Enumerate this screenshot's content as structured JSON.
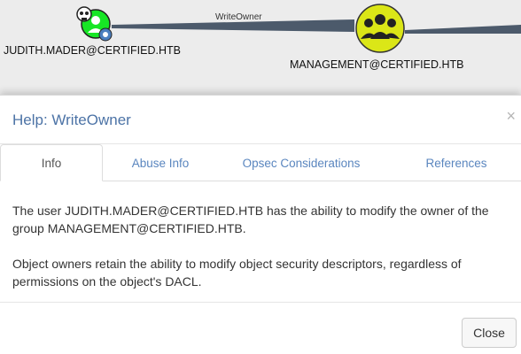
{
  "graph": {
    "edge_label": "WriteOwner",
    "source_node": {
      "label": "JUDITH.MADER@CERTIFIED.HTB",
      "icon": "user-icon"
    },
    "target_node": {
      "label": "MANAGEMENT@CERTIFIED.HTB",
      "icon": "group-icon"
    },
    "colors": {
      "user_node": "#17e625",
      "group_node": "#dbe617",
      "edge": "#4c5a6b"
    }
  },
  "modal": {
    "title": "Help: WriteOwner",
    "close_symbol": "×",
    "tabs": [
      {
        "label": "Info",
        "active": true
      },
      {
        "label": "Abuse Info",
        "active": false
      },
      {
        "label": "Opsec Considerations",
        "active": false
      },
      {
        "label": "References",
        "active": false
      }
    ],
    "body": {
      "paragraph_1": "The user JUDITH.MADER@CERTIFIED.HTB has the ability to modify the owner of the group MANAGEMENT@CERTIFIED.HTB.",
      "paragraph_2": "Object owners retain the ability to modify object security descriptors, regardless of permissions on the object's DACL."
    },
    "footer": {
      "close_label": "Close"
    },
    "colors": {
      "title": "#4c73a6",
      "tab_link": "#5a86bf"
    }
  }
}
